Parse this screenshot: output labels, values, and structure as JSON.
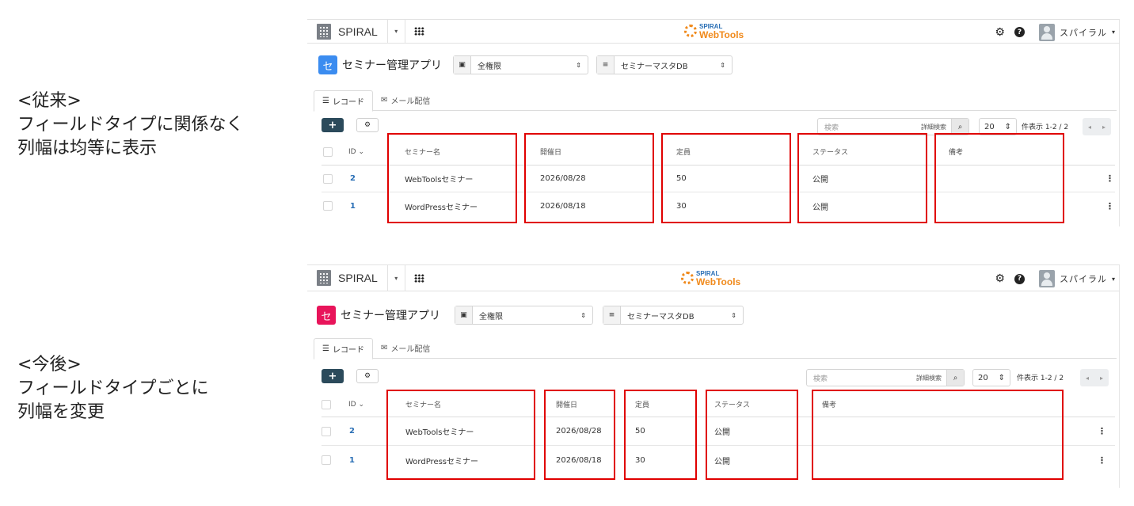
{
  "captions": {
    "before": [
      "<従来>",
      "フィールドタイプに関係なく",
      "列幅は均等に表示"
    ],
    "after": [
      "<今後>",
      "フィールドタイプごとに",
      "列幅を変更"
    ]
  },
  "colors": {
    "highlight": "#e00000",
    "app_icon_before": "#3b8cf0",
    "app_icon_after": "#e8145a"
  },
  "app": {
    "brand": "SPIRAL",
    "logo_line1": "SPIRAL",
    "logo_line2": "WebTools",
    "user_name": "スパイラル",
    "app_icon_char": "セ",
    "app_title": "セミナー管理アプリ",
    "permission_select": "全権限",
    "db_select": "セミナーマスタDB",
    "tabs": [
      "レコード",
      "メール配信"
    ],
    "add_label": "+",
    "search_placeholder": "検索",
    "advanced_search": "詳細検索",
    "per_page": "20",
    "count_text": "件表示  1-2 / 2",
    "columns": {
      "id": "ID",
      "name": "セミナー名",
      "date": "開催日",
      "capacity": "定員",
      "status": "ステータス",
      "note": "備考"
    },
    "rows": [
      {
        "id": "2",
        "name": "WebToolsセミナー",
        "date": "2026/08/28",
        "capacity": "50",
        "status": "公開",
        "note": ""
      },
      {
        "id": "1",
        "name": "WordPressセミナー",
        "date": "2026/08/18",
        "capacity": "30",
        "status": "公開",
        "note": ""
      }
    ]
  }
}
